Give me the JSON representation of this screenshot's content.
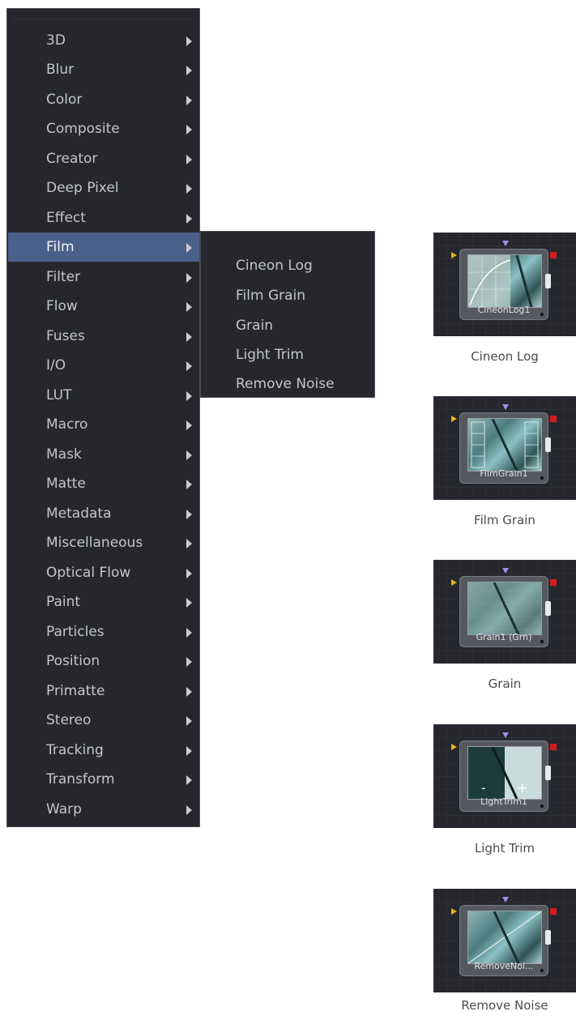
{
  "menu": {
    "items": [
      {
        "label": "3D"
      },
      {
        "label": "Blur"
      },
      {
        "label": "Color"
      },
      {
        "label": "Composite"
      },
      {
        "label": "Creator"
      },
      {
        "label": "Deep Pixel"
      },
      {
        "label": "Effect"
      },
      {
        "label": "Film",
        "highlighted": true
      },
      {
        "label": "Filter"
      },
      {
        "label": "Flow"
      },
      {
        "label": "Fuses"
      },
      {
        "label": "I/O"
      },
      {
        "label": "LUT"
      },
      {
        "label": "Macro"
      },
      {
        "label": "Mask"
      },
      {
        "label": "Matte"
      },
      {
        "label": "Metadata"
      },
      {
        "label": "Miscellaneous"
      },
      {
        "label": "Optical Flow"
      },
      {
        "label": "Paint"
      },
      {
        "label": "Particles"
      },
      {
        "label": "Position"
      },
      {
        "label": "Primatte"
      },
      {
        "label": "Stereo"
      },
      {
        "label": "Tracking"
      },
      {
        "label": "Transform"
      },
      {
        "label": "Warp"
      }
    ]
  },
  "submenu": {
    "items": [
      {
        "label": "Cineon Log"
      },
      {
        "label": "Film Grain"
      },
      {
        "label": "Grain"
      },
      {
        "label": "Light Trim"
      },
      {
        "label": "Remove Noise"
      }
    ]
  },
  "nodes": [
    {
      "title": "CineonLog1",
      "caption": "Cineon Log"
    },
    {
      "title": "FilmGrain1",
      "caption": "Film Grain"
    },
    {
      "title": "Grain1  (Grn)",
      "caption": "Grain"
    },
    {
      "title": "LightTrim1",
      "caption": "Light Trim",
      "minus": "-",
      "plus": "+"
    },
    {
      "title": "RemoveNoi...",
      "caption": "Remove Noise"
    }
  ],
  "colors": {
    "highlight": "#4b5f8b",
    "input_port": "#e6b222",
    "output_port": "#d21d1d",
    "mask_port": "#a38ee8"
  }
}
